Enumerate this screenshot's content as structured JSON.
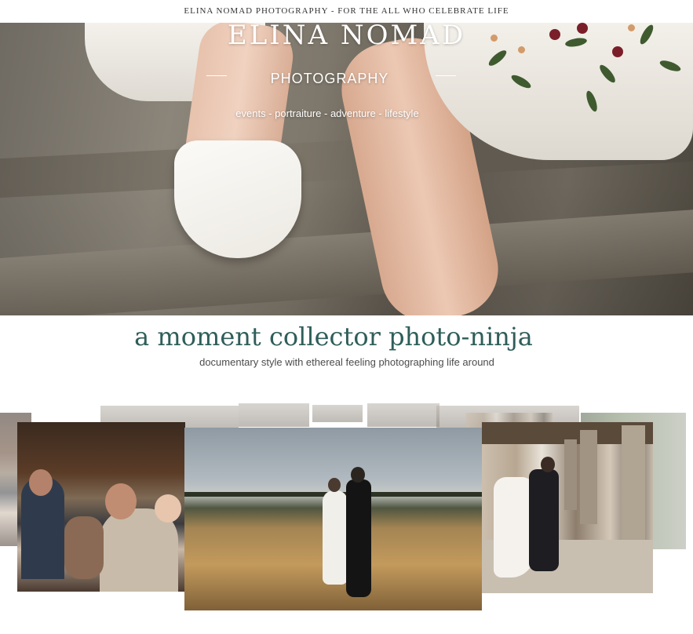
{
  "topbar": {
    "text": "ELINA NOMAD PHOTOGRAPHY - FOR THE ALL WHO CELEBRATE LIFE"
  },
  "hero": {
    "title": "ELINA NOMAD",
    "subtitle": "PHOTOGRAPHY",
    "tags": "events - portraiture - adventure - lifestyle"
  },
  "tagline": "a moment collector photo-ninja",
  "subtagline": "documentary style with ethereal feeling photographing life around",
  "gallery": {
    "photos": [
      {
        "name": "family-gathering-photo",
        "subject": "family-dinner"
      },
      {
        "name": "wedding-couple-field-photo",
        "subject": "couple-walking-field"
      },
      {
        "name": "wedding-couple-arcade-photo",
        "subject": "couple-embracing-colonnade"
      }
    ]
  },
  "colors": {
    "accent": "#2f5e5a",
    "text": "#4c4c4c",
    "topbar_text": "#333333"
  }
}
